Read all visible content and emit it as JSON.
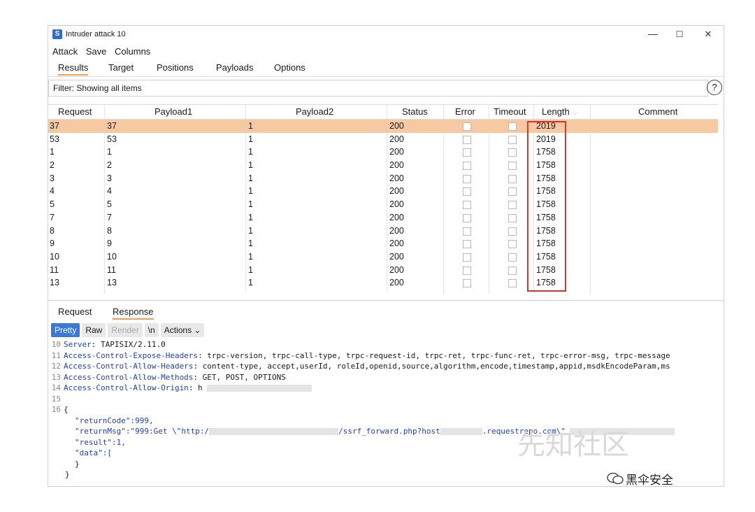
{
  "window": {
    "title": "Intruder attack 10",
    "app_icon": "S",
    "controls": [
      "—",
      "☐",
      "✕"
    ]
  },
  "menu": [
    "Attack",
    "Save",
    "Columns"
  ],
  "tabs": [
    "Results",
    "Target",
    "Positions",
    "Payloads",
    "Options"
  ],
  "filter": {
    "text": "Filter: Showing all items",
    "help": "?"
  },
  "table": {
    "columns": [
      "Request",
      "Payload1",
      "Payload2",
      "Status",
      "Error",
      "Timeout",
      "Length",
      "Comment"
    ],
    "length_sort_icon": "⌵",
    "rows": [
      {
        "request": "37",
        "p1": "37",
        "p2": "1",
        "status": "200",
        "length": "2019",
        "selected": true
      },
      {
        "request": "53",
        "p1": "53",
        "p2": "1",
        "status": "200",
        "length": "2019"
      },
      {
        "request": "1",
        "p1": "1",
        "p2": "1",
        "status": "200",
        "length": "1758"
      },
      {
        "request": "2",
        "p1": "2",
        "p2": "1",
        "status": "200",
        "length": "1758"
      },
      {
        "request": "3",
        "p1": "3",
        "p2": "1",
        "status": "200",
        "length": "1758"
      },
      {
        "request": "4",
        "p1": "4",
        "p2": "1",
        "status": "200",
        "length": "1758"
      },
      {
        "request": "5",
        "p1": "5",
        "p2": "1",
        "status": "200",
        "length": "1758"
      },
      {
        "request": "7",
        "p1": "7",
        "p2": "1",
        "status": "200",
        "length": "1758"
      },
      {
        "request": "8",
        "p1": "8",
        "p2": "1",
        "status": "200",
        "length": "1758"
      },
      {
        "request": "9",
        "p1": "9",
        "p2": "1",
        "status": "200",
        "length": "1758"
      },
      {
        "request": "10",
        "p1": "10",
        "p2": "1",
        "status": "200",
        "length": "1758"
      },
      {
        "request": "11",
        "p1": "11",
        "p2": "1",
        "status": "200",
        "length": "1758"
      },
      {
        "request": "13",
        "p1": "13",
        "p2": "1",
        "status": "200",
        "length": "1758"
      }
    ]
  },
  "response_tabs": [
    "Request",
    "Response"
  ],
  "viewer_buttons": {
    "pretty": "Pretty",
    "raw": "Raw",
    "render": "Render",
    "newline": "\\n",
    "actions": "Actions ⌄"
  },
  "code": {
    "line10": {
      "num": "10",
      "key": "Server",
      "val": ": TAPISIX/2.11.0"
    },
    "line11": {
      "num": "11",
      "key": "Access-Control-Expose-Headers",
      "val": ": trpc-version, trpc-call-type, trpc-request-id, trpc-ret, trpc-func-ret, trpc-error-msg, trpc-message"
    },
    "line12": {
      "num": "12",
      "key": "Access-Control-Allow-Headers",
      "val": ": content-type, accept,userId, roleId,openid,source,algorithm,encode,timestamp,appid,msdkEncodeParam,ms"
    },
    "line13": {
      "num": "13",
      "key": "Access-Control-Allow-Methods",
      "val": ": GET, POST, OPTIONS"
    },
    "line14": {
      "num": "14",
      "key": "Access-Control-Allow-Origin",
      "val": ": h"
    },
    "line15": {
      "num": "15"
    },
    "line16": {
      "num": "16",
      "text": "{"
    },
    "returnCode": "\"returnCode\":999,",
    "returnMsg_a": "\"returnMsg\":\"999:Get \\\"http:/",
    "returnMsg_b": "/ssrf_forward.php?host",
    "returnMsg_c": ".requestrepo.com\\\"",
    "result": "\"result\":1,",
    "data": "\"data\":[",
    "close1": "}",
    "close2": "}"
  },
  "watermark": "先知社区",
  "brand": "黑伞安全"
}
